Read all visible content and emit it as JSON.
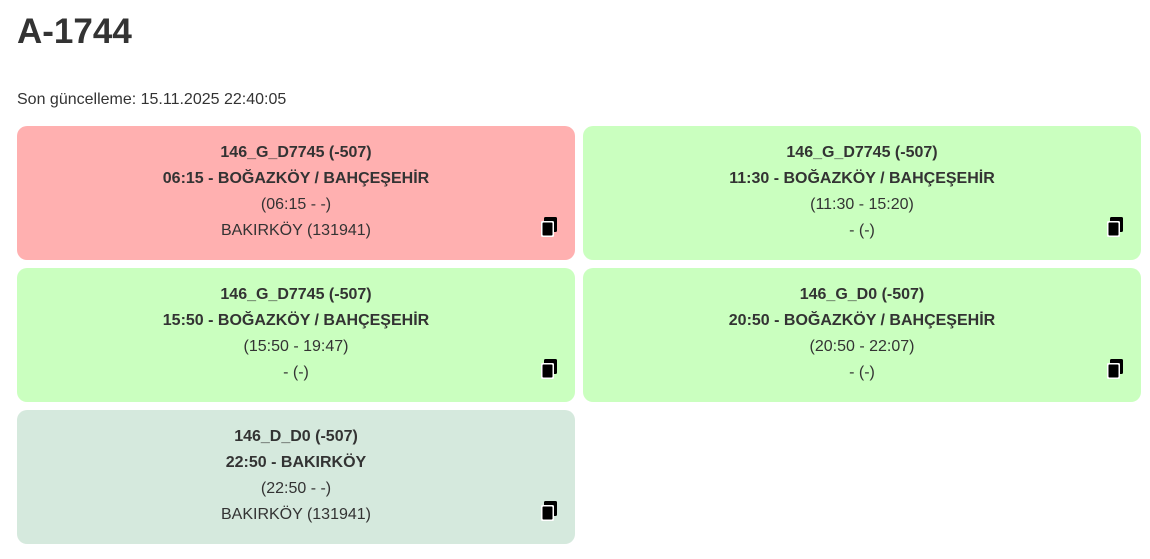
{
  "page": {
    "title": "A-1744",
    "last_update": "Son güncelleme: 15.11.2025 22:40:05"
  },
  "colors": {
    "red": "#ffb0b0",
    "green": "#caffbf",
    "sage": "#d5e9dd",
    "text": "#333333"
  },
  "cards": [
    {
      "status_color": "red",
      "code": "146_G_D7745 (-507)",
      "route": "06:15 - BOĞAZKÖY / BAHÇEŞEHİR",
      "times": "(06:15 - -)",
      "place": "BAKIRKÖY (131941)",
      "icon": "copy-icon"
    },
    {
      "status_color": "green",
      "code": "146_G_D7745 (-507)",
      "route": "11:30 - BOĞAZKÖY / BAHÇEŞEHİR",
      "times": "(11:30 - 15:20)",
      "place": "- (-)",
      "icon": "copy-icon"
    },
    {
      "status_color": "green",
      "code": "146_G_D7745 (-507)",
      "route": "15:50 - BOĞAZKÖY / BAHÇEŞEHİR",
      "times": "(15:50 - 19:47)",
      "place": "- (-)",
      "icon": "copy-icon"
    },
    {
      "status_color": "green",
      "code": "146_G_D0 (-507)",
      "route": "20:50 - BOĞAZKÖY / BAHÇEŞEHİR",
      "times": "(20:50 - 22:07)",
      "place": "- (-)",
      "icon": "copy-icon"
    },
    {
      "status_color": "sage",
      "code": "146_D_D0 (-507)",
      "route": "22:50 - BAKIRKÖY",
      "times": "(22:50 - -)",
      "place": "BAKIRKÖY (131941)",
      "icon": "copy-icon"
    }
  ]
}
